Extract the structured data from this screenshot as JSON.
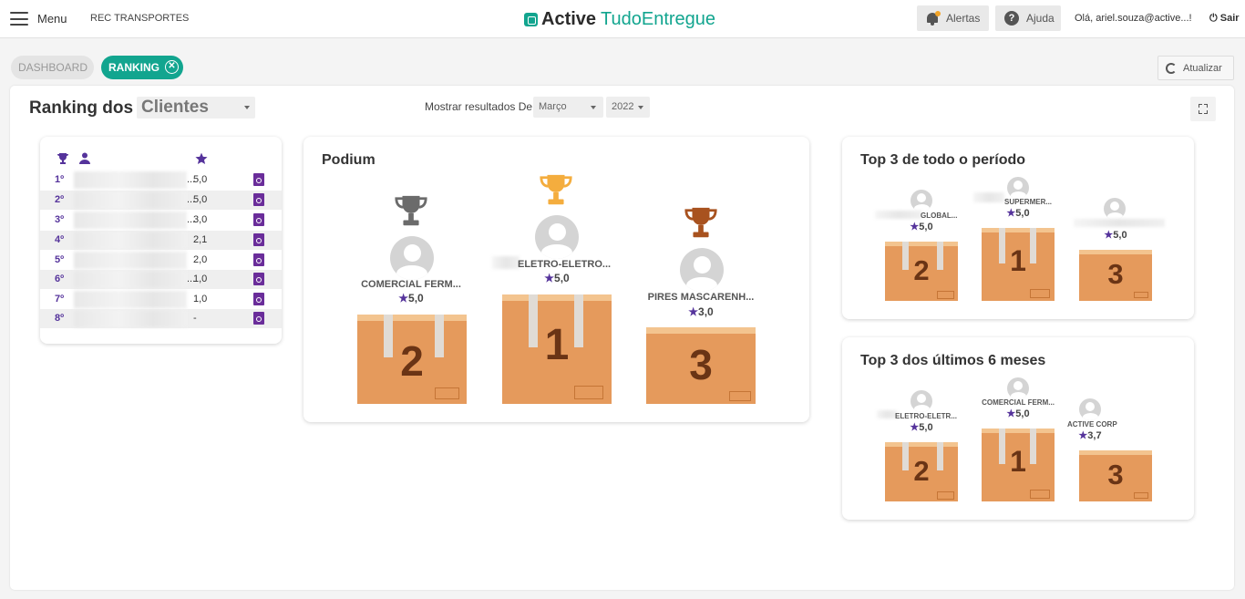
{
  "topbar": {
    "menu_label": "Menu",
    "company": "REC TRANSPORTES",
    "logo_bold": "Active",
    "logo_light": "TudoEntregue",
    "alerts_label": "Alertas",
    "help_label": "Ajuda",
    "greeting": "Olá, ariel.souza@active...!",
    "logout_label": "Sair"
  },
  "tabs": {
    "dashboard": "DASHBOARD",
    "ranking": "RANKING",
    "refresh_label": "Atualizar"
  },
  "header": {
    "title_prefix": "Ranking dos",
    "entity_selected": "Clientes",
    "show_results_label": "Mostrar resultados",
    "from_label": "De",
    "month_selected": "Março",
    "year_selected": "2022"
  },
  "ranking_table": {
    "rows": [
      {
        "pos": "1º",
        "ellipsis": "...",
        "score": "5,0"
      },
      {
        "pos": "2º",
        "ellipsis": "...",
        "score": "5,0"
      },
      {
        "pos": "3º",
        "ellipsis": "...",
        "score": "3,0"
      },
      {
        "pos": "4º",
        "ellipsis": "",
        "score": "2,1"
      },
      {
        "pos": "5º",
        "ellipsis": "",
        "score": "2,0"
      },
      {
        "pos": "6º",
        "ellipsis": "...",
        "score": "1,0"
      },
      {
        "pos": "7º",
        "ellipsis": "",
        "score": "1,0"
      },
      {
        "pos": "8º",
        "ellipsis": "",
        "score": "-"
      }
    ]
  },
  "podium": {
    "title": "Podium",
    "first": {
      "name": "ELETRO-ELETRO...",
      "score": "5,0",
      "rank": "1"
    },
    "second": {
      "name": "COMERCIAL FERM...",
      "score": "5,0",
      "rank": "2"
    },
    "third": {
      "name": "PIRES MASCARENH...",
      "score": "3,0",
      "rank": "3"
    }
  },
  "top_all": {
    "title": "Top 3 de todo o período",
    "first": {
      "name": "SUPERMER...",
      "score": "5,0",
      "rank": "1"
    },
    "second": {
      "name": "GLOBAL...",
      "score": "5,0",
      "rank": "2"
    },
    "third": {
      "name": "",
      "score": "5,0",
      "rank": "3"
    }
  },
  "top_6m": {
    "title": "Top 3 dos últimos 6 meses",
    "first": {
      "name": "COMERCIAL FERM...",
      "score": "5,0",
      "rank": "1"
    },
    "second": {
      "name": "ELETRO-ELETR...",
      "score": "5,0",
      "rank": "2"
    },
    "third": {
      "name": "ACTIVE CORP",
      "score": "3,7",
      "rank": "3"
    }
  },
  "colors": {
    "accent": "#12a58f",
    "purple": "#55339b",
    "gold": "#f4ad3e",
    "silver": "#6b6b6b",
    "bronze": "#a8521f",
    "box": "#e59a5c"
  }
}
